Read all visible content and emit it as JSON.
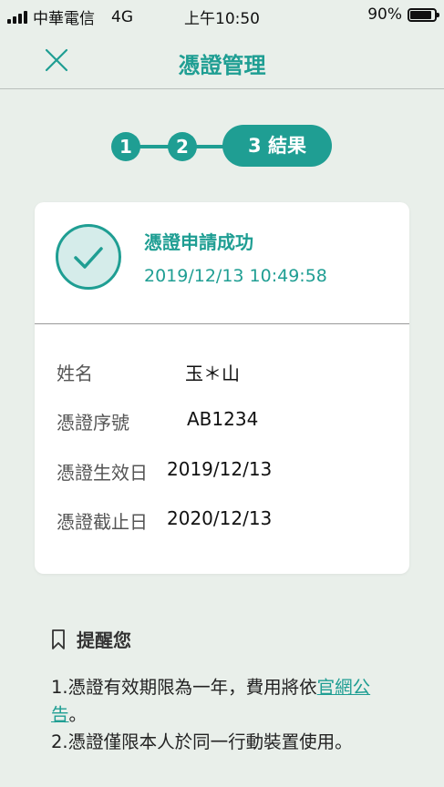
{
  "status_bar": {
    "carrier": "中華電信",
    "network": "4G",
    "time": "上午10:50",
    "battery_text": "90%",
    "battery_level": 0.9
  },
  "header": {
    "title": "憑證管理",
    "close_icon": "close-icon"
  },
  "stepper": {
    "steps": [
      {
        "label": "1"
      },
      {
        "label": "2"
      },
      {
        "label": "3 結果"
      }
    ],
    "active_index": 2
  },
  "result": {
    "icon": "check-icon",
    "title": "憑證申請成功",
    "timestamp": "2019/12/13 10:49:58"
  },
  "details": [
    {
      "label": "姓名",
      "value": "玉＊山"
    },
    {
      "label": "憑證序號",
      "value": "AB1234"
    },
    {
      "label": "憑證生效日",
      "value": "2019/12/13"
    },
    {
      "label": "憑證截止日",
      "value": "2020/12/13"
    }
  ],
  "reminder": {
    "icon": "bookmark-icon",
    "title": "提醒您",
    "item1_text": "1.憑證有效期限為一年，費用將依",
    "item1_link": "官網公告",
    "item1_tail": "。",
    "item2_text": "2.憑證僅限本人於同一行動裝置使用。"
  },
  "colors": {
    "accent": "#1f9e93",
    "background": "#e9efea",
    "card": "#ffffff"
  }
}
